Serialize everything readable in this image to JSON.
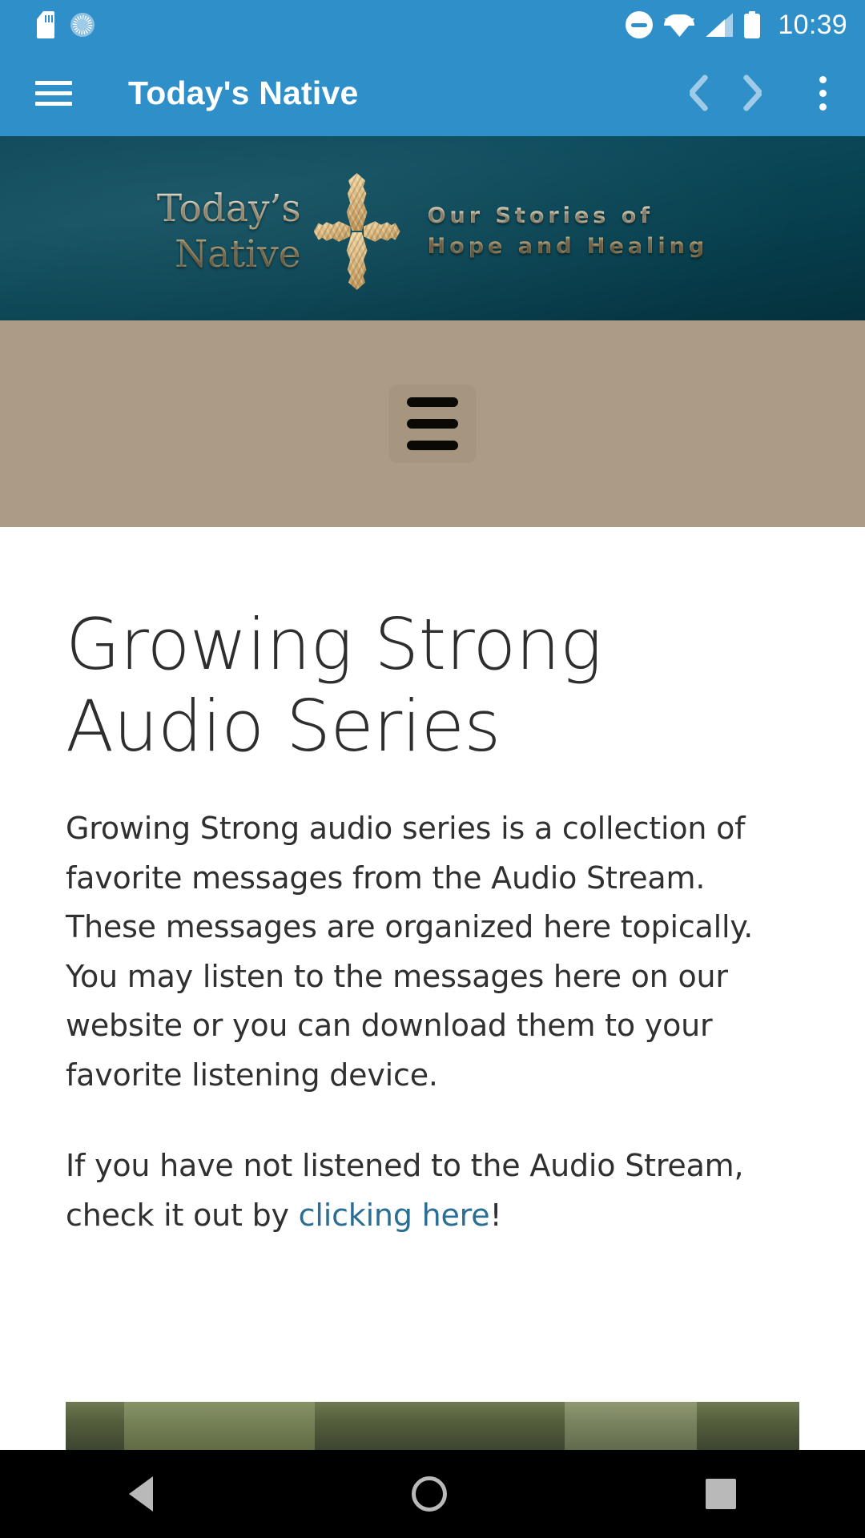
{
  "status_bar": {
    "clock": "10:39",
    "icons": [
      {
        "name": "sd-card-icon"
      },
      {
        "name": "sync-progress-icon"
      },
      {
        "name": "do-not-disturb-icon"
      },
      {
        "name": "wifi-icon"
      },
      {
        "name": "cellular-signal-icon"
      },
      {
        "name": "battery-icon"
      }
    ],
    "background_color": "#2e8fc9"
  },
  "app_bar": {
    "title": "Today's Native",
    "menu_icon": "hamburger-icon",
    "back_label": "‹",
    "forward_label": "›",
    "overflow_label": "⋮",
    "background_color": "#2e8fc9",
    "title_color": "#ffffff"
  },
  "banner": {
    "brand_line1": "Today’s",
    "brand_line2": "Native",
    "tagline_line1": "Our Stories of",
    "tagline_line2": "Hope and Healing",
    "logo_icon": "arrowhead-cross-icon",
    "background_color": "#0a4657",
    "text_color": "#d6c49a"
  },
  "site_nav": {
    "menu_icon": "site-hamburger-icon",
    "background_color": "#ac9b85"
  },
  "content": {
    "title": "Growing Strong Audio Series",
    "paragraph_1": "Growing Strong audio series is a collection of favorite messages from the Audio Stream. These messages are organized here topically. You may listen to the messages here on our website or you can download them to your favorite listening device.",
    "paragraph_2_before": "If you have not listened to the Audio Stream, check it out by ",
    "paragraph_2_link": "clicking here",
    "paragraph_2_after": "!",
    "link_color": "#2b6e94",
    "text_color": "#303030"
  },
  "nav_bar": {
    "back": "back-triangle",
    "home": "home-circle",
    "recents": "recents-square",
    "background_color": "#000000"
  }
}
